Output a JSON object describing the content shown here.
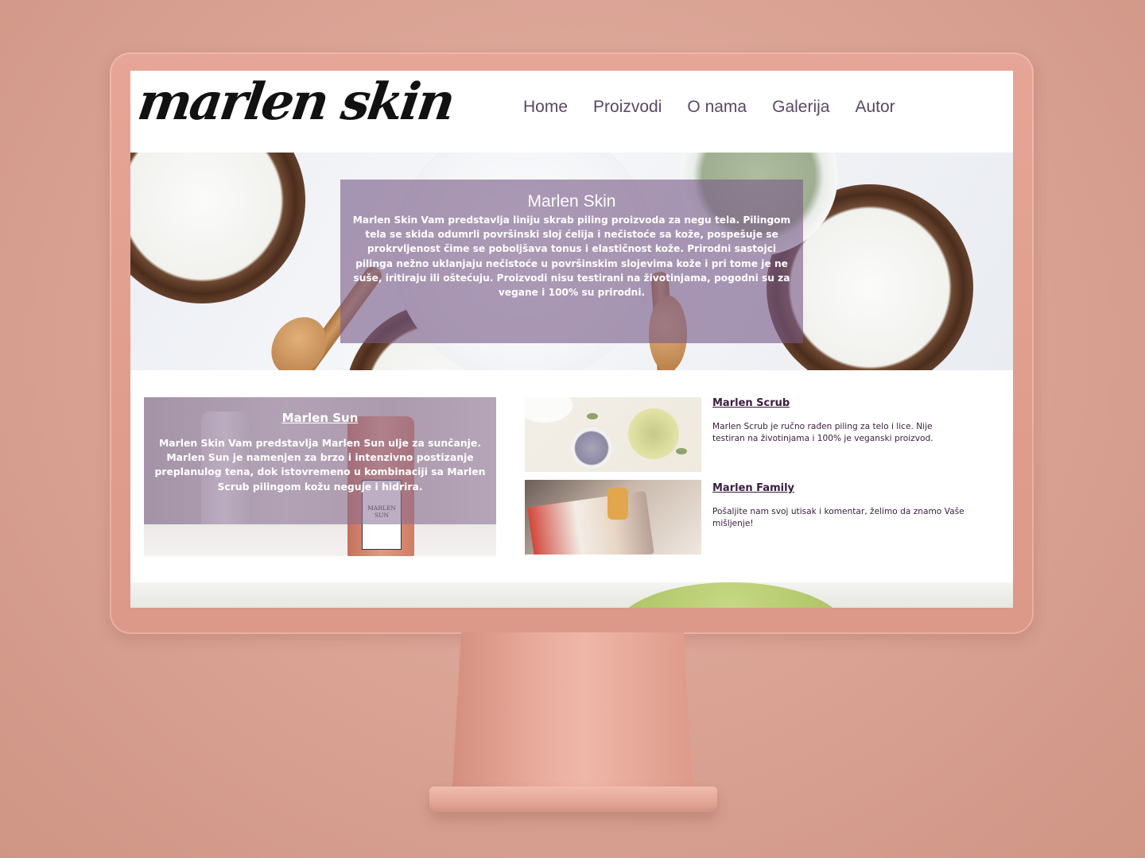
{
  "site": {
    "logo": "marlen skin"
  },
  "nav": {
    "items": [
      "Home",
      "Proizvodi",
      "O nama",
      "Galerija",
      "Autor"
    ]
  },
  "hero": {
    "title": "Marlen Skin",
    "text": "Marlen Skin Vam predstavlja liniju skrab piling proizvoda za negu tela. Pilingom tela se skida odumrli površinski sloj ćelija i nečistoće sa kože, pospešuje se prokrvljenost čime se poboljšava tonus i elastičnost kože. Prirodni sastojci pilinga nežno uklanjaju nečistoće u površinskim slojevima kože i pri tome je ne suše, iritiraju ili oštećuju. Proizvodi nisu testirani na životinjama, pogodni su za vegane i 100% su prirodni."
  },
  "sun": {
    "title": "Marlen Sun",
    "text": "Marlen Skin Vam predstavlja Marlen Sun ulje za sunčanje. Marlen Sun je namenjen za brzo i intenzivno postizanje preplanulog tena, dok istovremeno u kombinaciji sa Marlen Scrub pilingom kožu neguje i hidrira.",
    "bottle_label": "MARLEN SUN"
  },
  "scrub": {
    "title": "Marlen Scrub",
    "text": "Marlen Scrub je ručno rađen piling za telo i lice. Nije testiran na životinjama i 100% je veganski proizvod."
  },
  "family": {
    "title": "Marlen Family",
    "text": "Pošaljite nam svoj utisak i komentar, želimo da znamo Vaše mišljenje!"
  },
  "colors": {
    "accent": "#5a4766",
    "panel": "#785a87",
    "heading": "#3b1c40",
    "background": "#d9a293"
  }
}
